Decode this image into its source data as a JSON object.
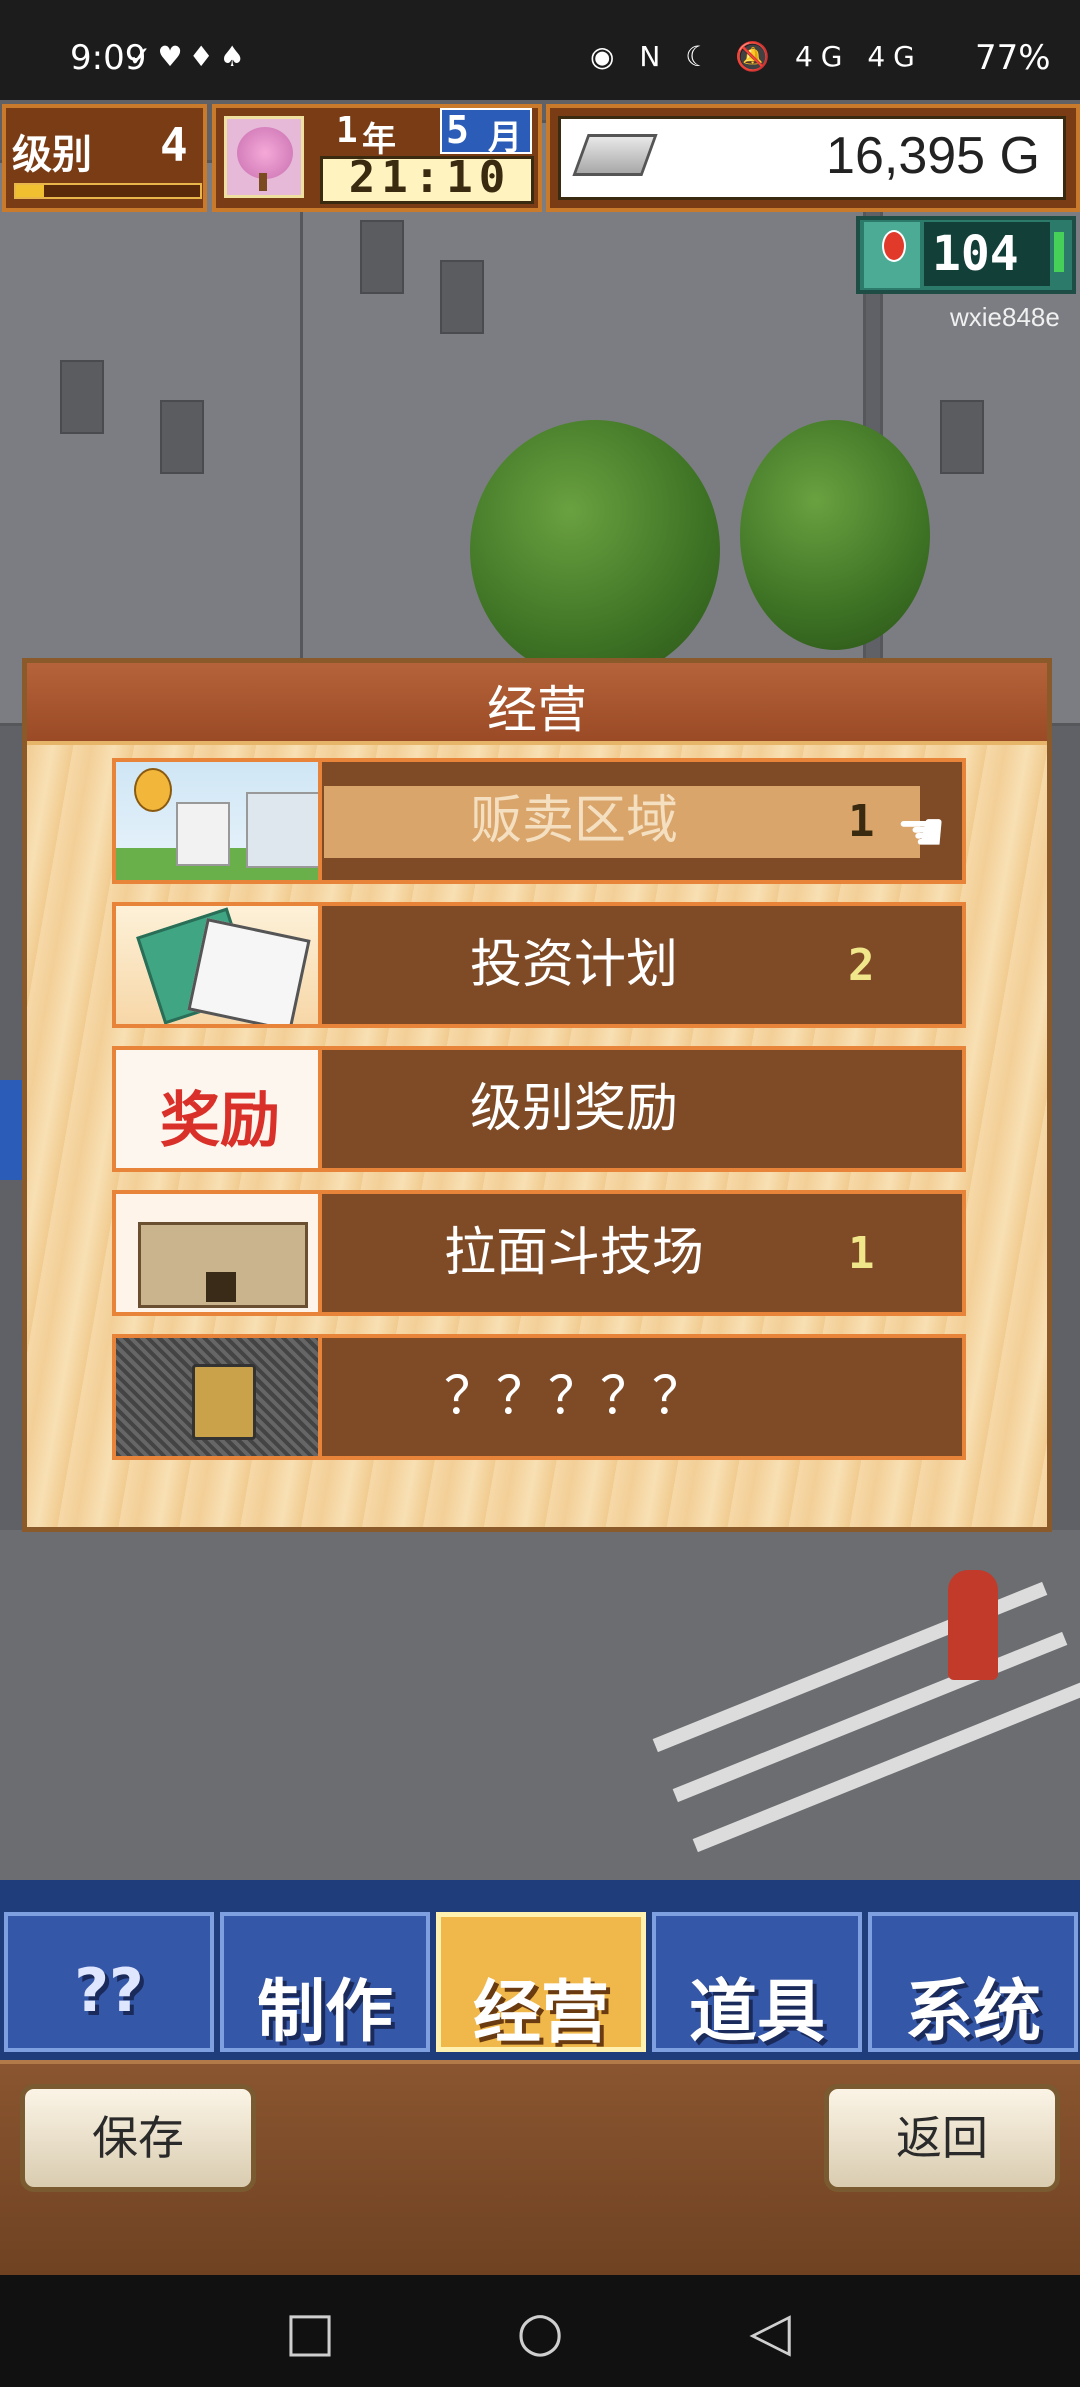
{
  "status_bar": {
    "time": "9:09",
    "left_icons": "✓♥♦♠",
    "right_icons": "◉ N ☾ 🔕 4G 4G",
    "battery": "77%"
  },
  "hud": {
    "level_label": "级别",
    "level_value": "4",
    "level_progress": 0.15,
    "year_value": "1",
    "year_label": "年",
    "month_value": "5",
    "month_label": "月",
    "clock": "21:10",
    "money": "16,395 G",
    "fans": "104",
    "player_id": "wxie848e"
  },
  "dialog": {
    "title": "经营",
    "items": [
      {
        "label": "贩卖区域",
        "badge": "1",
        "selected": true,
        "icon": "sales-area-icon"
      },
      {
        "label": "投资计划",
        "badge": "2",
        "selected": false,
        "icon": "investment-book-icon"
      },
      {
        "label": "级别奖励",
        "badge": "",
        "selected": false,
        "icon": "reward-icon",
        "icon_text": "奖励"
      },
      {
        "label": "拉面斗技场",
        "badge": "1",
        "selected": false,
        "icon": "arena-icon"
      },
      {
        "label": "？？？？？",
        "badge": "",
        "selected": false,
        "icon": "lock-icon"
      }
    ]
  },
  "tabs": [
    {
      "label": "??",
      "active": false
    },
    {
      "label": "制作",
      "active": false
    },
    {
      "label": "经营",
      "active": true
    },
    {
      "label": "道具",
      "active": false
    },
    {
      "label": "系统",
      "active": false
    }
  ],
  "buttons": {
    "save": "保存",
    "back": "返回"
  },
  "nav": {
    "recent": "□",
    "home": "○",
    "back": "◁"
  }
}
